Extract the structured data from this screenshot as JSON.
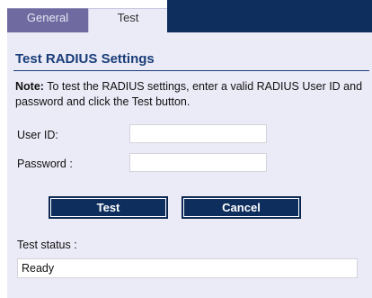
{
  "tabs": [
    {
      "label": "General",
      "active": false
    },
    {
      "label": "Test",
      "active": true
    }
  ],
  "section": {
    "title": "Test RADIUS Settings",
    "note_prefix": "Note:",
    "note_text": " To test the RADIUS settings, enter a valid RADIUS User ID and password and click the Test button."
  },
  "form": {
    "user_id": {
      "label": "User ID:",
      "value": ""
    },
    "password": {
      "label": "Password :",
      "value": ""
    }
  },
  "buttons": {
    "test": "Test",
    "cancel": "Cancel"
  },
  "status": {
    "label": "Test status :",
    "value": "Ready"
  },
  "colors": {
    "header_navy": "#0e2f5e",
    "panel_background": "#ebeaf7",
    "inactive_tab": "#6f6aa0",
    "title_blue": "#193d78"
  }
}
